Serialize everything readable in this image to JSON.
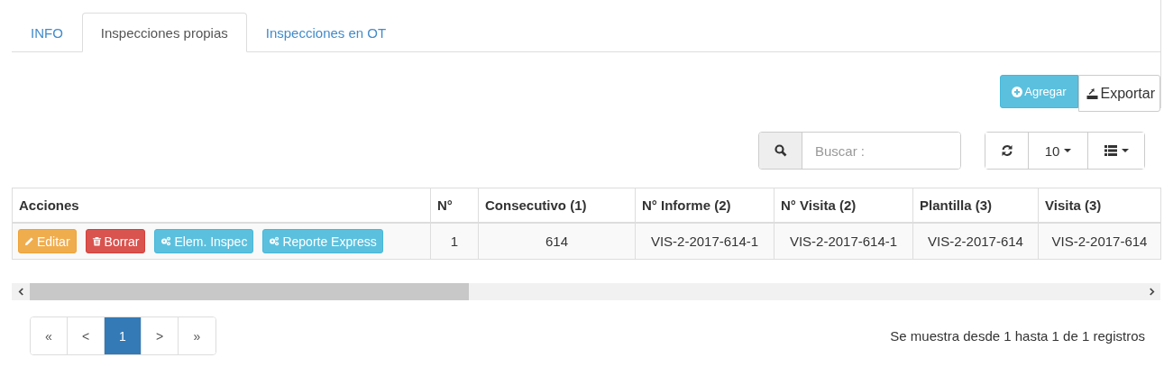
{
  "tabs": [
    {
      "label": "INFO",
      "selected": false
    },
    {
      "label": "Inspecciones propias",
      "selected": true
    },
    {
      "label": "Inspecciones en OT",
      "selected": false
    }
  ],
  "toolbar": {
    "add_button": "Agregar",
    "export_button": "Exportar"
  },
  "search": {
    "placeholder": "Buscar :"
  },
  "page_size": "10",
  "table": {
    "columns": [
      "Acciones",
      "N°",
      "Consecutivo (1)",
      "N° Informe (2)",
      "N° Visita (2)",
      "Plantilla (3)",
      "Visita (3)"
    ],
    "rows": [
      {
        "cells": [
          {
            "actions": [
              {
                "label": "Editar",
                "kind": "edit"
              },
              {
                "label": "Borrar",
                "kind": "delete"
              },
              {
                "label": "Elem. Inspec",
                "kind": "gears"
              },
              {
                "label": "Reporte Express",
                "kind": "gears"
              }
            ]
          },
          "1",
          "614",
          "VIS-2-2017-614-1",
          "VIS-2-2017-614-1",
          "VIS-2-2017-614",
          "VIS-2-2017-614"
        ]
      }
    ]
  },
  "pagination": [
    {
      "label": "«",
      "selected": false
    },
    {
      "label": "<",
      "selected": false
    },
    {
      "label": "1",
      "selected": true
    },
    {
      "label": ">",
      "selected": false
    },
    {
      "label": "»",
      "selected": false
    }
  ],
  "summary": "Se muestra desde 1 hasta 1 de 1 registros"
}
